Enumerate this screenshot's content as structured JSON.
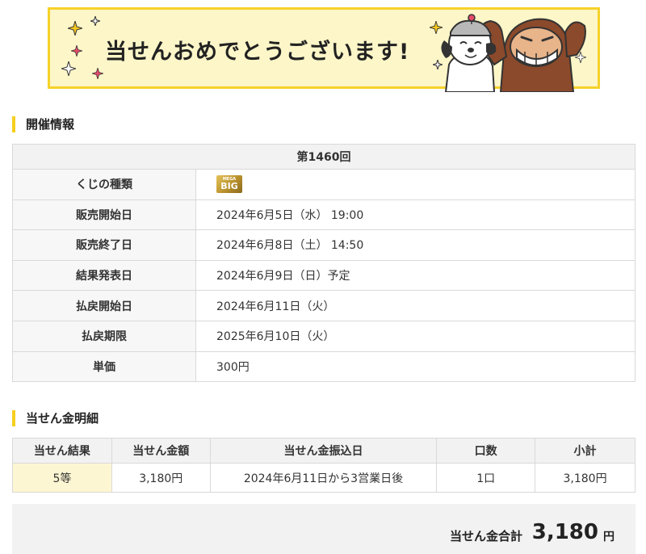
{
  "banner": {
    "title": "当せんおめでとうございます!",
    "icons": [
      "sparkle-icon",
      "monkey-mascot",
      "dog-mascot"
    ],
    "colors": {
      "background": "#fdf6c8",
      "border": "#f6d22a"
    }
  },
  "event_info": {
    "heading": "開催情報",
    "round": "第1460回",
    "rows": [
      {
        "label": "くじの種類",
        "value": "",
        "logo": {
          "top": "MEGA",
          "bottom": "BIG"
        }
      },
      {
        "label": "販売開始日",
        "value": "2024年6月5日（水） 19:00"
      },
      {
        "label": "販売終了日",
        "value": "2024年6月8日（土） 14:50"
      },
      {
        "label": "結果発表日",
        "value": "2024年6月9日（日）予定"
      },
      {
        "label": "払戻開始日",
        "value": "2024年6月11日（火）"
      },
      {
        "label": "払戻期限",
        "value": "2025年6月10日（火）"
      },
      {
        "label": "単価",
        "value": "300円"
      }
    ]
  },
  "winnings": {
    "heading": "当せん金明細",
    "columns": [
      "当せん結果",
      "当せん金額",
      "当せん金振込日",
      "口数",
      "小計"
    ],
    "rows": [
      {
        "result": "5等",
        "amount": "3,180円",
        "transfer_date": "2024年6月11日から3営業日後",
        "count": "1口",
        "subtotal": "3,180円"
      }
    ]
  },
  "total": {
    "label": "当せん金合計",
    "amount": "3,180",
    "unit": "円"
  },
  "colors": {
    "accent": "#f6cf1e",
    "highlight": "#fdf6d2",
    "header_bg": "#f2f2f2"
  }
}
